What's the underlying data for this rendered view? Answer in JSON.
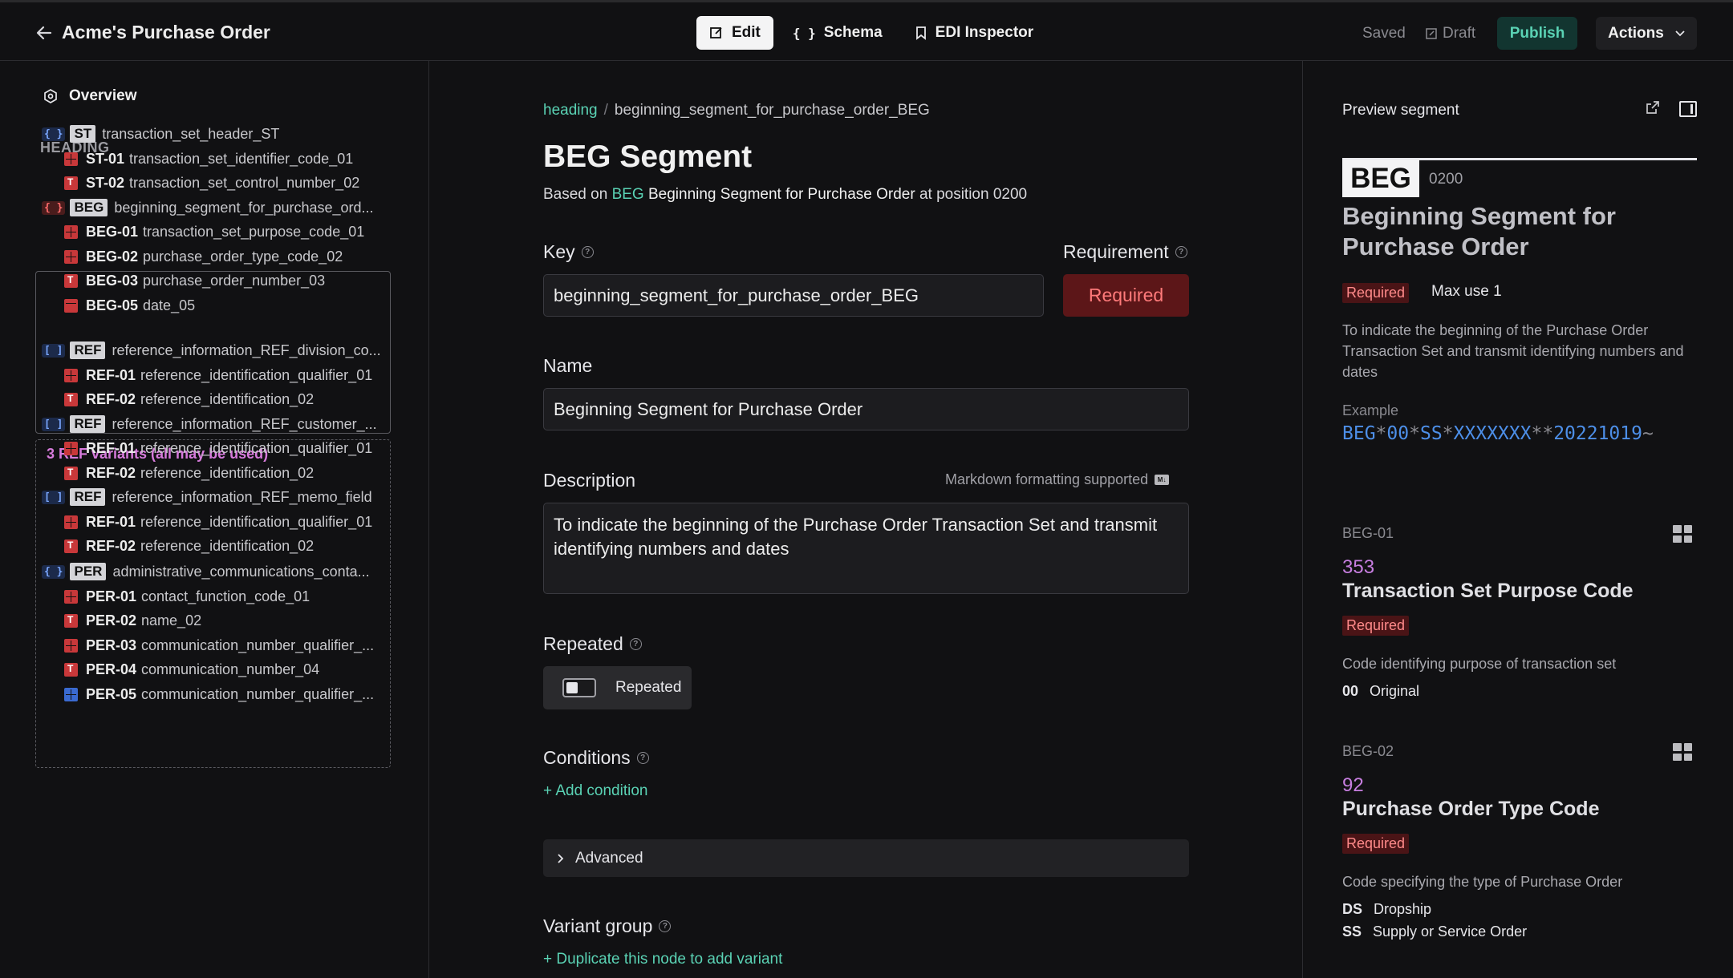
{
  "header": {
    "title": "Acme's Purchase Order",
    "tabs": [
      {
        "label": "Edit",
        "icon": "edit-icon"
      },
      {
        "label": "Schema",
        "icon": "braces-icon"
      },
      {
        "label": "EDI Inspector",
        "icon": "bookmark-icon"
      }
    ],
    "status_saved": "Saved",
    "status_draft": "Draft",
    "publish_label": "Publish",
    "actions_label": "Actions"
  },
  "sidebar": {
    "overview_label": "Overview",
    "section_heading": "HEADING",
    "ref_variants_label": "3 REF variants (all may be used)",
    "rows": [
      {
        "kind": "segment",
        "brace": "{ }",
        "brace_color": "blue",
        "tag": "ST",
        "label": "transaction_set_header_ST"
      },
      {
        "kind": "element",
        "icon": "grid",
        "code": "ST-01",
        "label": "transaction_set_identifier_code_01"
      },
      {
        "kind": "element",
        "icon": "text",
        "code": "ST-02",
        "label": "transaction_set_control_number_02"
      },
      {
        "kind": "segment",
        "brace": "{ }",
        "brace_color": "red",
        "tag": "BEG",
        "label": "beginning_segment_for_purchase_ord..."
      },
      {
        "kind": "element",
        "icon": "grid",
        "code": "BEG-01",
        "label": "transaction_set_purpose_code_01"
      },
      {
        "kind": "element",
        "icon": "grid",
        "code": "BEG-02",
        "label": "purchase_order_type_code_02"
      },
      {
        "kind": "element",
        "icon": "text",
        "code": "BEG-03",
        "label": "purchase_order_number_03"
      },
      {
        "kind": "element",
        "icon": "cal",
        "code": "BEG-05",
        "label": "date_05"
      },
      {
        "kind": "segment",
        "brace": "[ ]",
        "brace_color": "blue",
        "tag": "REF",
        "label": "reference_information_REF_division_co..."
      },
      {
        "kind": "element",
        "icon": "grid",
        "code": "REF-01",
        "label": "reference_identification_qualifier_01"
      },
      {
        "kind": "element",
        "icon": "text",
        "code": "REF-02",
        "label": "reference_identification_02"
      },
      {
        "kind": "segment",
        "brace": "[ ]",
        "brace_color": "blue",
        "tag": "REF",
        "label": "reference_information_REF_customer_..."
      },
      {
        "kind": "element",
        "icon": "grid",
        "code": "REF-01",
        "label": "reference_identification_qualifier_01"
      },
      {
        "kind": "element",
        "icon": "text",
        "code": "REF-02",
        "label": "reference_identification_02"
      },
      {
        "kind": "segment",
        "brace": "[ ]",
        "brace_color": "blue",
        "tag": "REF",
        "label": "reference_information_REF_memo_field"
      },
      {
        "kind": "element",
        "icon": "grid",
        "code": "REF-01",
        "label": "reference_identification_qualifier_01"
      },
      {
        "kind": "element",
        "icon": "text",
        "code": "REF-02",
        "label": "reference_identification_02"
      },
      {
        "kind": "segment",
        "brace": "{ }",
        "brace_color": "blue",
        "tag": "PER",
        "label": "administrative_communications_conta..."
      },
      {
        "kind": "element",
        "icon": "grid",
        "code": "PER-01",
        "label": "contact_function_code_01"
      },
      {
        "kind": "element",
        "icon": "text",
        "code": "PER-02",
        "label": "name_02"
      },
      {
        "kind": "element",
        "icon": "grid",
        "code": "PER-03",
        "label": "communication_number_qualifier_..."
      },
      {
        "kind": "element",
        "icon": "text",
        "code": "PER-04",
        "label": "communication_number_04"
      },
      {
        "kind": "element",
        "icon": "gridblue",
        "code": "PER-05",
        "label": "communication_number_qualifier_..."
      }
    ]
  },
  "main": {
    "breadcrumb_link": "heading",
    "breadcrumb_sep": "/",
    "breadcrumb_current": "beginning_segment_for_purchase_order_BEG",
    "title": "BEG Segment",
    "based_on_prefix": "Based on",
    "based_on_code": "BEG",
    "based_on_name": "Beginning Segment for Purchase Order",
    "based_on_suffix": "at position 0200",
    "key_label": "Key",
    "key_value": "beginning_segment_for_purchase_order_BEG",
    "requirement_label": "Requirement",
    "requirement_value": "Required",
    "name_label": "Name",
    "name_value": "Beginning Segment for Purchase Order",
    "description_label": "Description",
    "markdown_note": "Markdown formatting supported",
    "description_value": "To indicate the beginning of the Purchase Order Transaction Set and transmit identifying numbers and dates",
    "repeated_label": "Repeated",
    "repeated_toggle_label": "Repeated",
    "conditions_label": "Conditions",
    "add_condition": "+ Add condition",
    "advanced_label": "Advanced",
    "variant_group_label": "Variant group",
    "duplicate_link": "+ Duplicate this node to add variant"
  },
  "preview": {
    "label": "Preview segment",
    "tag": "BEG",
    "position": "0200",
    "title": "Beginning Segment for Purchase Order",
    "required": "Required",
    "max_use": "Max use 1",
    "description": "To indicate the beginning of the Purchase Order Transaction Set and transmit identifying numbers and dates",
    "example_label": "Example",
    "example_parts": [
      "BEG",
      "*",
      "00",
      "*",
      "SS",
      "*",
      "XXXXXXX",
      "*",
      "*",
      "20221019",
      "~"
    ],
    "elements": [
      {
        "id": "BEG-01",
        "number": "353",
        "name": "Transaction Set Purpose Code",
        "required": "Required",
        "desc": "Code identifying purpose of transaction set",
        "codes": [
          {
            "code": "00",
            "label": "Original"
          }
        ]
      },
      {
        "id": "BEG-02",
        "number": "92",
        "name": "Purchase Order Type Code",
        "required": "Required",
        "desc": "Code specifying the type of Purchase Order",
        "codes": [
          {
            "code": "DS",
            "label": "Dropship"
          },
          {
            "code": "SS",
            "label": "Supply or Service Order"
          }
        ]
      }
    ]
  }
}
